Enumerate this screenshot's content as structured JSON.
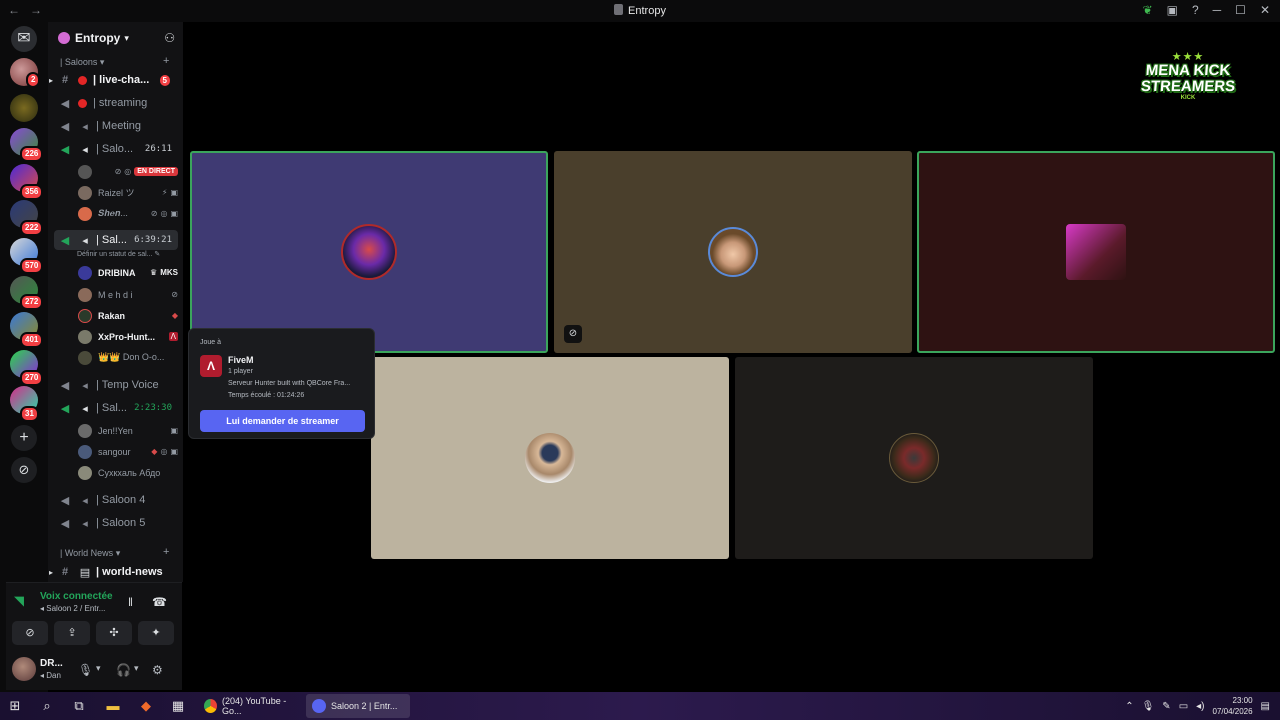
{
  "window": {
    "title": "Entropy"
  },
  "server": {
    "name": "Entropy"
  },
  "rail": {
    "badges": [
      "2",
      "226",
      "356",
      "222",
      "570",
      "272",
      "401",
      "270",
      "31"
    ]
  },
  "channels": {
    "cat_saloons": "| Saloons",
    "cat_world": "| World News",
    "items": [
      {
        "label": "| live-cha...",
        "unread": "5"
      },
      {
        "label": "| streaming"
      },
      {
        "label": "| Meeting"
      },
      {
        "label": "| Salo...",
        "timer": "26:11"
      },
      {
        "label": "| Sal...",
        "timer": "6:39:21",
        "status": "Définir un statut de sal..."
      },
      {
        "label": "| Temp Voice"
      },
      {
        "label": "| Sal...",
        "timer": "2:23:30"
      },
      {
        "label": "| Saloon 4"
      },
      {
        "label": "| Saloon 5"
      },
      {
        "label": "| world-news"
      }
    ],
    "members_a": [
      {
        "name": "",
        "live": "EN DIRECT"
      },
      {
        "name": "Raizel ツ"
      },
      {
        "name": "𝑺𝒉𝒆𝒏..."
      }
    ],
    "members_b": [
      {
        "name": "DRIBINA",
        "tag": "MKS"
      },
      {
        "name": "M e h d i"
      },
      {
        "name": "Rakan"
      },
      {
        "name": "XxPro-Hunt..."
      },
      {
        "name": "👑👑 Don O-o..."
      }
    ],
    "members_c": [
      {
        "name": "Jen!!Yen"
      },
      {
        "name": "sangour"
      },
      {
        "name": "Сухкхаль Абдо"
      }
    ]
  },
  "voice": {
    "connected": "Voix connectée",
    "location": "Saloon 2 / Entr...",
    "user_name": "DR...",
    "user_status": "Dan"
  },
  "popout": {
    "label": "Joue à",
    "game": "FiveM",
    "players": "1 player",
    "desc": "Serveur Hunter built with QBCore Fra...",
    "time": "Temps écoulé : 01:24:26",
    "button": "Lui demander de streamer"
  },
  "logo": {
    "line1": "MENA KICK",
    "line2": "STREAMERS",
    "small": "KICK"
  },
  "taskbar": {
    "app1": "(204) YouTube - Go...",
    "app2": "Saloon 2 | Entr...",
    "time": "23:00",
    "date": "07/04/2026"
  },
  "colors": {
    "accent": "#5865f2",
    "speaking": "#3ba55c",
    "danger": "#f23f43"
  }
}
